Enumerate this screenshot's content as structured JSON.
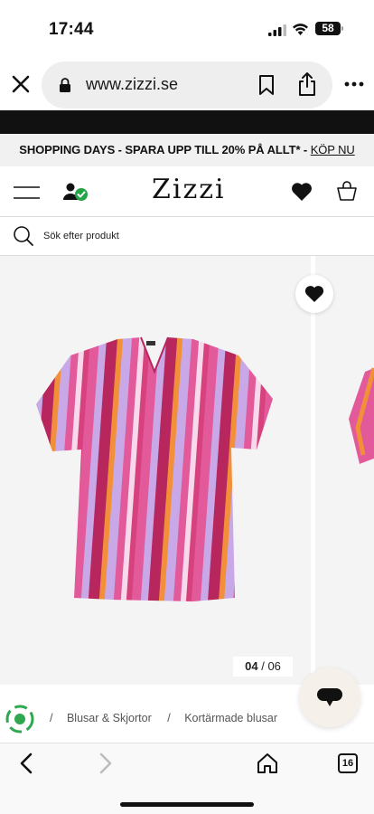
{
  "status_bar": {
    "time": "17:44",
    "battery": "58"
  },
  "browser": {
    "url": "www.zizzi.se",
    "tab_count": "16"
  },
  "promo": {
    "text": "SHOPPING DAYS - SPARA UPP TILL 20% PÅ ALLT* - ",
    "link": "KÖP NU"
  },
  "header": {
    "logo": "Zizzi"
  },
  "search": {
    "placeholder": "Sök efter produkt"
  },
  "gallery": {
    "current": "04",
    "separator": "/",
    "total": "06"
  },
  "breadcrumb": {
    "items": [
      "Blusar & Skjortor",
      "Kortärmade blusar"
    ],
    "separator": "/",
    "partial_title": "..."
  },
  "colors": {
    "stripe_pink": "#e35a9b",
    "stripe_magenta": "#b8265e",
    "stripe_lilac": "#c9a8e8",
    "stripe_orange": "#f2903a",
    "stripe_light": "#f6d9ea"
  }
}
